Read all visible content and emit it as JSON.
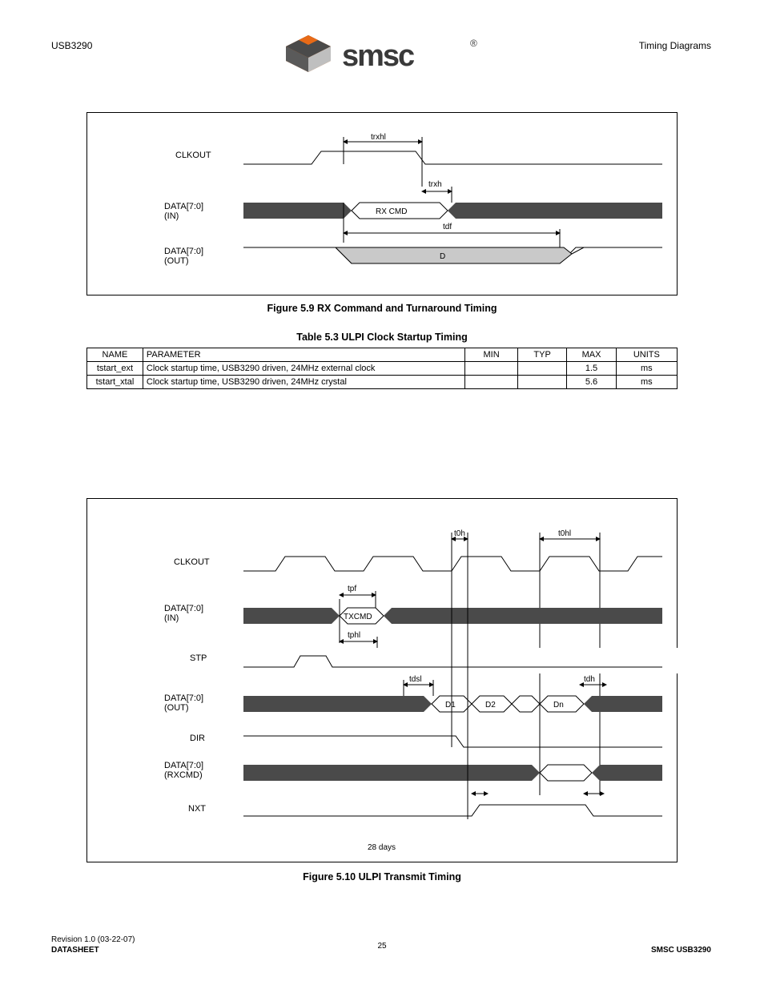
{
  "header": {
    "product": "USB3290",
    "chapter": "Timing Diagrams"
  },
  "logo": {
    "brand": "smsc",
    "reg": "®"
  },
  "figure5_9": {
    "caption": "Figure 5.9 RX Command and Turnaround Timing",
    "labels": {
      "clk": "CLKOUT",
      "data_in": "DATA[7:0]\n(IN)",
      "data_out": "DATA[7:0]\n(OUT)",
      "trxhl": "trxhl",
      "trxh": "trxh",
      "tdf": "tdf",
      "rx_cmd": "RX CMD",
      "dline": "D"
    }
  },
  "table5_3": {
    "caption": "Table 5.3 ULPI Clock Startup Timing",
    "cols": [
      "NAME",
      "PARAMETER",
      "MIN",
      "TYP",
      "MAX",
      "UNITS"
    ],
    "rows": [
      [
        "tstart_ext",
        "Clock startup time, USB3290 driven, 24MHz external clock",
        "",
        "",
        "1.5",
        "ms"
      ],
      [
        "tstart_xtal",
        "Clock startup time, USB3290 driven, 24MHz crystal",
        "",
        "",
        "5.6",
        "ms"
      ]
    ]
  },
  "figure5_10": {
    "caption": "Figure 5.10 ULPI Transmit Timing",
    "labels": {
      "clk": "CLKOUT",
      "data_in": "DATA[7:0]\n(IN)",
      "stp": "STP",
      "data_out": "DATA[7:0]\n(OUT)",
      "dir": "DIR",
      "data_rx": "DATA[7:0]\n(RXCMD)",
      "nxt": "NXT",
      "tpf": "tpf",
      "tphl": "tphl",
      "t0h": "t0h",
      "t0hl": "t0hl",
      "tdsl": "tdsl",
      "tdh": "tdh",
      "txcmd": "TXCMD",
      "d1": "D1",
      "d2": "D2",
      "dn": "Dn",
      "footer": [
        "28 days",
        ""
      ]
    }
  },
  "footer": {
    "left_line1": "Revision 1.0 (03-22-07)",
    "left_line2": "DATASHEET",
    "page": "25",
    "right_line1": "SMSC USB3290"
  }
}
